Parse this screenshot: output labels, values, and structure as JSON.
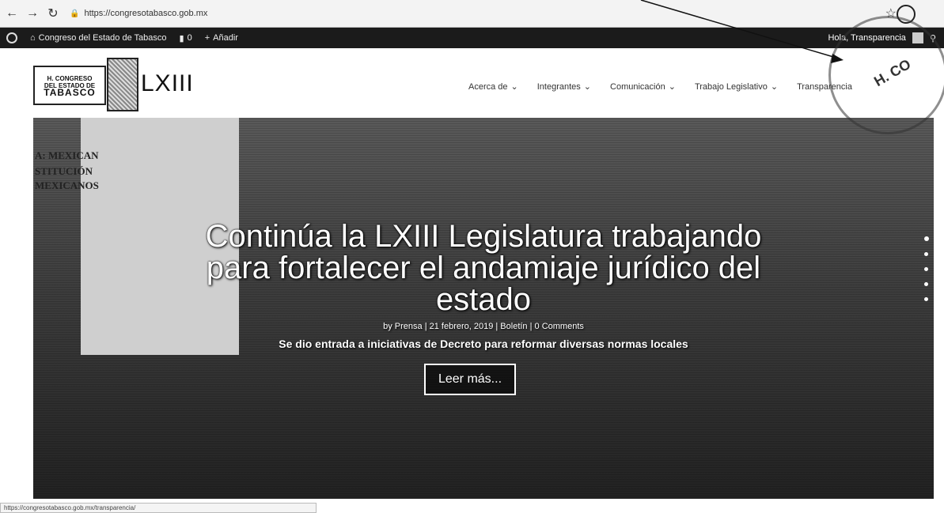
{
  "browser": {
    "url": "https://congresotabasco.gob.mx"
  },
  "adminbar": {
    "site_name": "Congreso del Estado de Tabasco",
    "comments_count": "0",
    "add_label": "Añadir",
    "greeting": "Hola, Transparencia"
  },
  "header": {
    "logo_line1": "H. CONGRESO",
    "logo_line2": "DEL ESTADO DE",
    "logo_line3": "TABASCO",
    "legislature": "LXIII",
    "nav": [
      {
        "label": "Acerca de"
      },
      {
        "label": "Integrantes"
      },
      {
        "label": "Comunicación"
      },
      {
        "label": "Trabajo Legislativo"
      },
      {
        "label": "Transparencia"
      }
    ]
  },
  "hero": {
    "title_line1": "Continúa la LXIII Legislatura trabajando",
    "title_line2": "para fortalecer el andamiaje jurídico del",
    "title_line3": "estado",
    "meta": "by Prensa | 21 febrero, 2019 | Boletín | 0 Comments",
    "summary": "Se dio entrada a iniciativas de Decreto para reformar diversas normas locales",
    "button_label": "Leer más...",
    "wall_lines": [
      "A: MEXICAN",
      "STITUCIÓN",
      "MEXICANOS"
    ]
  },
  "statusbar": {
    "text": "https://congresotabasco.gob.mx/transparencia/"
  }
}
